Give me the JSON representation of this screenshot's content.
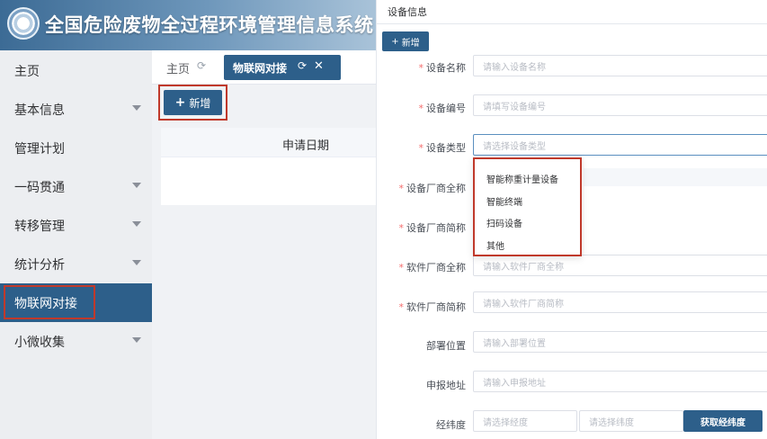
{
  "header": {
    "title": "全国危险废物全过程环境管理信息系统"
  },
  "sidebar": {
    "items": [
      {
        "label": "主页",
        "has_submenu": false,
        "active": false
      },
      {
        "label": "基本信息",
        "has_submenu": true,
        "active": false
      },
      {
        "label": "管理计划",
        "has_submenu": false,
        "active": false
      },
      {
        "label": "一码贯通",
        "has_submenu": true,
        "active": false
      },
      {
        "label": "转移管理",
        "has_submenu": true,
        "active": false
      },
      {
        "label": "统计分析",
        "has_submenu": true,
        "active": false
      },
      {
        "label": "物联网对接",
        "has_submenu": false,
        "active": true
      },
      {
        "label": "小微收集",
        "has_submenu": true,
        "active": false
      }
    ]
  },
  "tabs": {
    "home": "主页",
    "active": "物联网对接"
  },
  "toolbar": {
    "add_label": "新增"
  },
  "table": {
    "headers": [
      "申请日期"
    ]
  },
  "panel": {
    "title": "设备信息",
    "add_label": "新增",
    "fields": [
      {
        "label": "设备名称",
        "required": true,
        "placeholder": "请输入设备名称"
      },
      {
        "label": "设备编号",
        "required": true,
        "placeholder": "请填写设备编号"
      },
      {
        "label": "设备类型",
        "required": true,
        "placeholder": "请选择设备类型"
      },
      {
        "label": "设备厂商全称",
        "required": true,
        "placeholder": ""
      },
      {
        "label": "设备厂商简称",
        "required": true,
        "placeholder": ""
      },
      {
        "label": "软件厂商全称",
        "required": true,
        "placeholder": "请输入软件厂商全称"
      },
      {
        "label": "软件厂商简称",
        "required": true,
        "placeholder": "请输入软件厂商简称"
      },
      {
        "label": "部署位置",
        "required": false,
        "placeholder": "请输入部署位置"
      },
      {
        "label": "申报地址",
        "required": false,
        "placeholder": "请输入申报地址"
      },
      {
        "label": "经纬度",
        "required": false,
        "placeholder": ""
      }
    ],
    "lng_placeholder": "请选择经度",
    "lat_placeholder": "请选择纬度",
    "get_lnglat_label": "获取经纬度",
    "device_type_options": [
      "智能称重计量设备",
      "智能终端",
      "扫码设备",
      "其他"
    ]
  },
  "colors": {
    "primary": "#2d5f8a",
    "highlight": "#c0392b",
    "required": "#f56c6c"
  },
  "icons": [
    "logo-emblem-icon",
    "chevron-down-icon",
    "refresh-icon",
    "close-icon",
    "plus-icon"
  ]
}
